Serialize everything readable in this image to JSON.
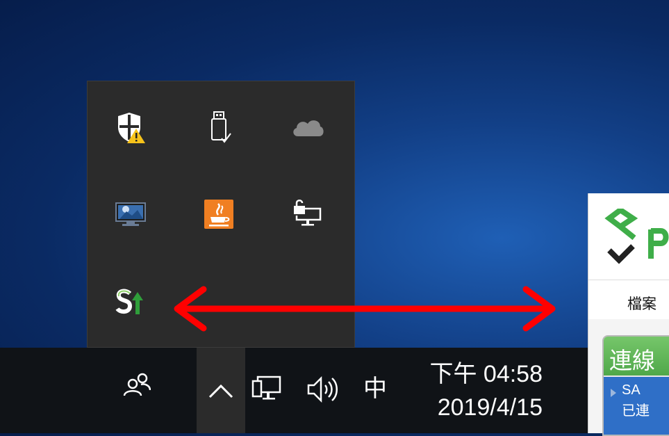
{
  "taskbar": {
    "clock_time": "下午 04:58",
    "clock_date": "2019/4/15",
    "ime_indicator": "中",
    "icons": [
      "people-icon",
      "chevron-up-icon",
      "network-icon",
      "volume-icon"
    ]
  },
  "tray_overflow": {
    "icons": [
      "windows-security-warning-icon",
      "usb-safe-remove-icon",
      "onedrive-cloud-icon",
      "remote-desktop-monitor-icon",
      "java-icon",
      "vpn-locked-monitor-icon",
      "sync-upload-icon"
    ]
  },
  "app_window": {
    "menu_file": "檔案",
    "panel_title": "連線",
    "connection_name": "SA",
    "connection_status": "已連"
  },
  "annotation": {
    "arrow_color": "#ff0000"
  }
}
